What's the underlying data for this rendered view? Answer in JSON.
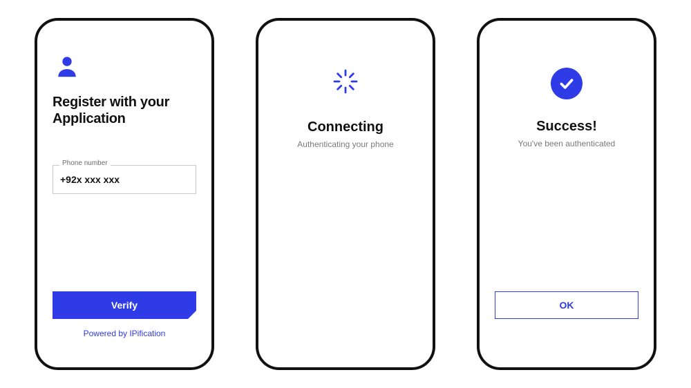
{
  "colors": {
    "primary": "#2e3be6"
  },
  "screen1": {
    "icon": "person-icon",
    "title_line1": "Register with your",
    "title_line2": "Application",
    "phone_label": "Phone number",
    "phone_value": "+92x xxx xxx",
    "verify_label": "Verify",
    "powered_by": "Powered by IPification"
  },
  "screen2": {
    "icon": "spinner-icon",
    "title": "Connecting",
    "subtitle": "Authenticating your phone"
  },
  "screen3": {
    "icon": "checkmark-icon",
    "title": "Success!",
    "subtitle": "You've been authenticated",
    "ok_label": "OK"
  }
}
